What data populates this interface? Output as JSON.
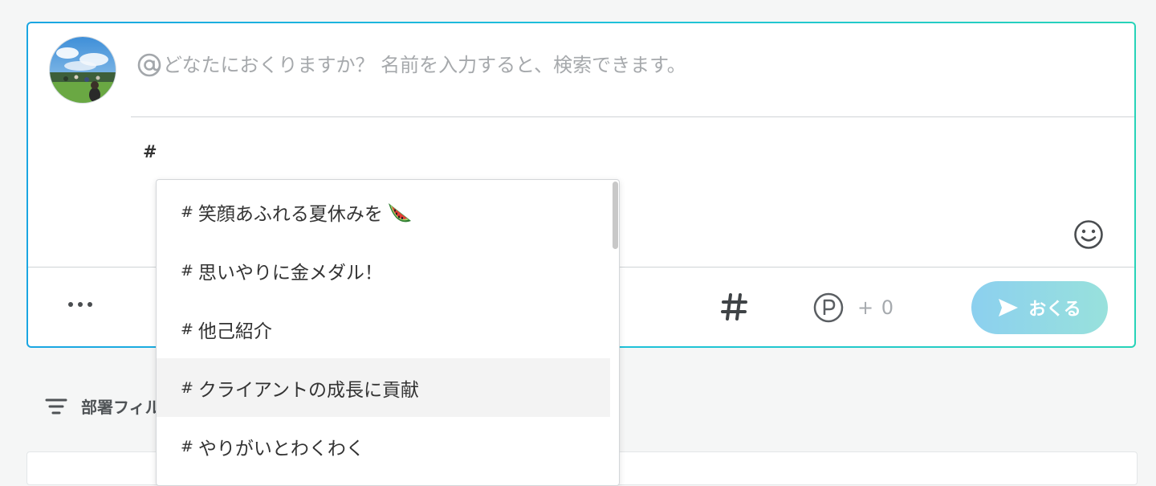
{
  "composer": {
    "avatar_alt": "user avatar",
    "recipient": {
      "placeholder": "どなたにおくりますか？ 名前を入力すると、検索できます。",
      "value": ""
    },
    "message": {
      "value": "#"
    },
    "toolbar": {
      "more_icon": "more-horizontal-icon",
      "hashtag_icon": "hashtag-icon",
      "points_icon": "point-p-icon",
      "points_text": "+ 0",
      "send_label": "おくる",
      "send_icon": "paper-plane-icon"
    },
    "colors": {
      "border_gradient_start": "#1aa6e2",
      "border_gradient_end": "#27d3b8",
      "send_gradient_start": "#8cd0ef",
      "send_gradient_end": "#98e1dc"
    }
  },
  "hashtag_suggestions": {
    "items": [
      {
        "hash": "#",
        "label": "笑顔あふれる夏休みを",
        "emoji": "watermelon"
      },
      {
        "hash": "#",
        "label": "思いやりに金メダル！"
      },
      {
        "hash": "#",
        "label": "他己紹介"
      },
      {
        "hash": "#",
        "label": "クライアントの成長に貢献",
        "highlighted": true
      },
      {
        "hash": "#",
        "label": "やりがいとわくわく"
      }
    ]
  },
  "filter": {
    "icon": "filter-icon",
    "label": "部署フィル"
  }
}
